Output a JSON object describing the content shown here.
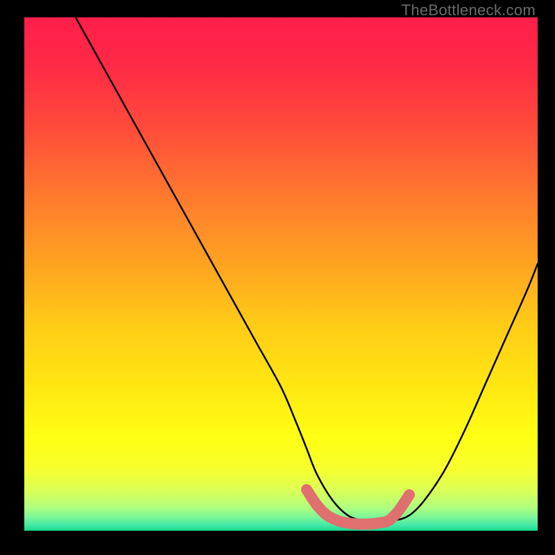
{
  "watermark": "TheBottleneck.com",
  "gradient": {
    "stops": [
      {
        "offset": 0.0,
        "color": "#ff1e4b"
      },
      {
        "offset": 0.1,
        "color": "#ff2b45"
      },
      {
        "offset": 0.22,
        "color": "#ff4d3a"
      },
      {
        "offset": 0.35,
        "color": "#ff7a2e"
      },
      {
        "offset": 0.48,
        "color": "#ffa321"
      },
      {
        "offset": 0.6,
        "color": "#ffcc17"
      },
      {
        "offset": 0.72,
        "color": "#ffe712"
      },
      {
        "offset": 0.82,
        "color": "#ffff14"
      },
      {
        "offset": 0.88,
        "color": "#f6ff2e"
      },
      {
        "offset": 0.92,
        "color": "#dcff55"
      },
      {
        "offset": 0.955,
        "color": "#b0ff7e"
      },
      {
        "offset": 0.975,
        "color": "#78f59a"
      },
      {
        "offset": 0.99,
        "color": "#40e8a5"
      },
      {
        "offset": 1.0,
        "color": "#18d98f"
      }
    ]
  },
  "chart_data": {
    "type": "line",
    "title": "",
    "xlabel": "",
    "ylabel": "",
    "xlim": [
      0,
      100
    ],
    "ylim": [
      0,
      100
    ],
    "series": [
      {
        "name": "black-curve",
        "x": [
          10,
          15,
          20,
          25,
          30,
          35,
          40,
          45,
          50,
          53,
          55,
          57,
          60,
          63,
          66,
          69,
          72,
          75,
          78,
          82,
          86,
          90,
          94,
          98,
          100
        ],
        "y": [
          100,
          91,
          82,
          73,
          64,
          55,
          46,
          37,
          28,
          21,
          16,
          11,
          6,
          3,
          2,
          2,
          2,
          3,
          6,
          12,
          20,
          29,
          38,
          47,
          52
        ]
      },
      {
        "name": "pink-bottom-segment",
        "x": [
          55,
          57,
          59,
          61,
          63,
          65,
          67,
          69,
          71,
          73,
          75
        ],
        "y": [
          8,
          5,
          3,
          2,
          1.5,
          1.3,
          1.3,
          1.5,
          2,
          4,
          7
        ]
      }
    ],
    "annotations": []
  }
}
